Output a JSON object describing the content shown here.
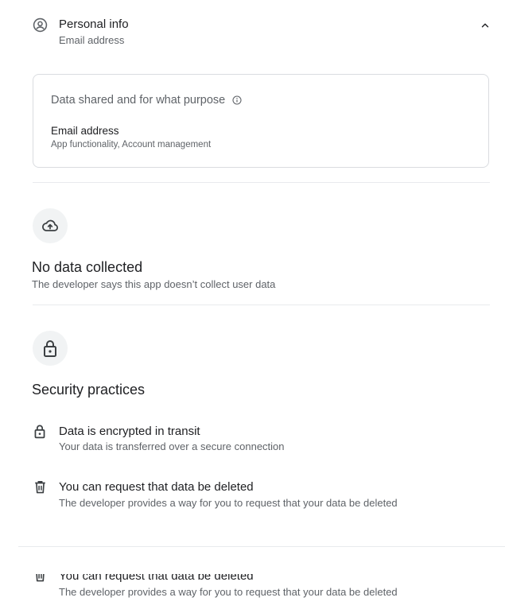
{
  "personal_info": {
    "title": "Personal info",
    "subtitle": "Email address",
    "icon": "account-circle-icon",
    "toggle_icon": "chevron-up-icon"
  },
  "shared_card": {
    "title": "Data shared and for what purpose",
    "info_icon": "info-icon",
    "item_title": "Email address",
    "item_sub": "App functionality, Account management"
  },
  "no_data": {
    "icon": "cloud-upload-icon",
    "title": "No data collected",
    "subtitle": "The developer says this app doesn’t collect user data"
  },
  "security": {
    "icon": "lock-icon",
    "title": "Security practices",
    "items": [
      {
        "icon": "lock-icon",
        "title": "Data is encrypted in transit",
        "subtitle": "Your data is transferred over a secure connection"
      },
      {
        "icon": "trash-icon",
        "title": "You can request that data be deleted",
        "subtitle": "The developer provides a way for you to request that your data be deleted"
      }
    ]
  },
  "clipped_item": {
    "icon": "trash-icon",
    "title": "You can request that data be deleted",
    "subtitle": "The developer provides a way for you to request that your data be deleted"
  },
  "colors": {
    "text_primary": "#202124",
    "text_secondary": "#5f6368",
    "border": "#dadce0",
    "icon_circle": "#f1f3f4"
  }
}
